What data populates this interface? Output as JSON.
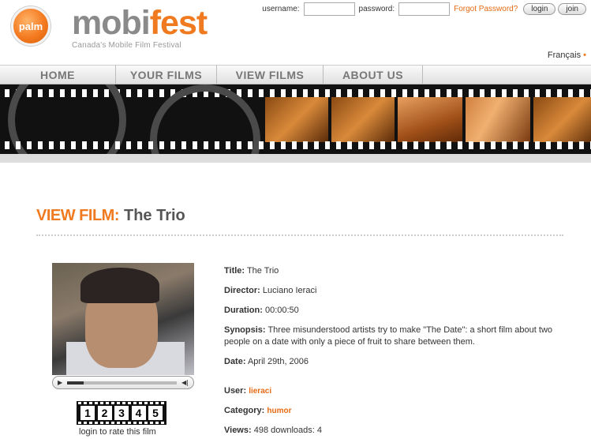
{
  "header": {
    "palm_logo_text": "palm",
    "brand_mobi": "mobi",
    "brand_fest": "fest",
    "tagline": "Canada's Mobile Film Festival"
  },
  "login": {
    "username_label": "username:",
    "password_label": "password:",
    "forgot_label": "Forgot Password?",
    "login_label": "login",
    "join_label": "join"
  },
  "lang": {
    "label": "Français"
  },
  "nav": {
    "items": [
      "HOME",
      "YOUR FILMS",
      "VIEW FILMS",
      "ABOUT US"
    ]
  },
  "page": {
    "section_label": "VIEW FILM:",
    "film_title": "The Trio"
  },
  "player": {
    "play_icon": "▶",
    "volume_icon": "◀|",
    "progress": 0.15
  },
  "rating": {
    "stars": [
      "1",
      "2",
      "3",
      "4",
      "5"
    ],
    "prompt": "login to rate this film"
  },
  "details": {
    "title_label": "Title:",
    "title_value": "The Trio",
    "director_label": "Director:",
    "director_value": "Luciano Ieraci",
    "duration_label": "Duration:",
    "duration_value": "00:00:50",
    "synopsis_label": "Synopsis:",
    "synopsis_value": "Three misunderstood artists try to make \"The Date\": a short film about two people on a date with only a piece of fruit to share between them.",
    "date_label": "Date:",
    "date_value": "April 29th, 2006",
    "user_label": "User:",
    "user_value": "lieraci",
    "category_label": "Category:",
    "category_value": "humor",
    "views_label": "Views:",
    "views_value": "498",
    "downloads_label": "downloads:",
    "downloads_value": "4"
  }
}
